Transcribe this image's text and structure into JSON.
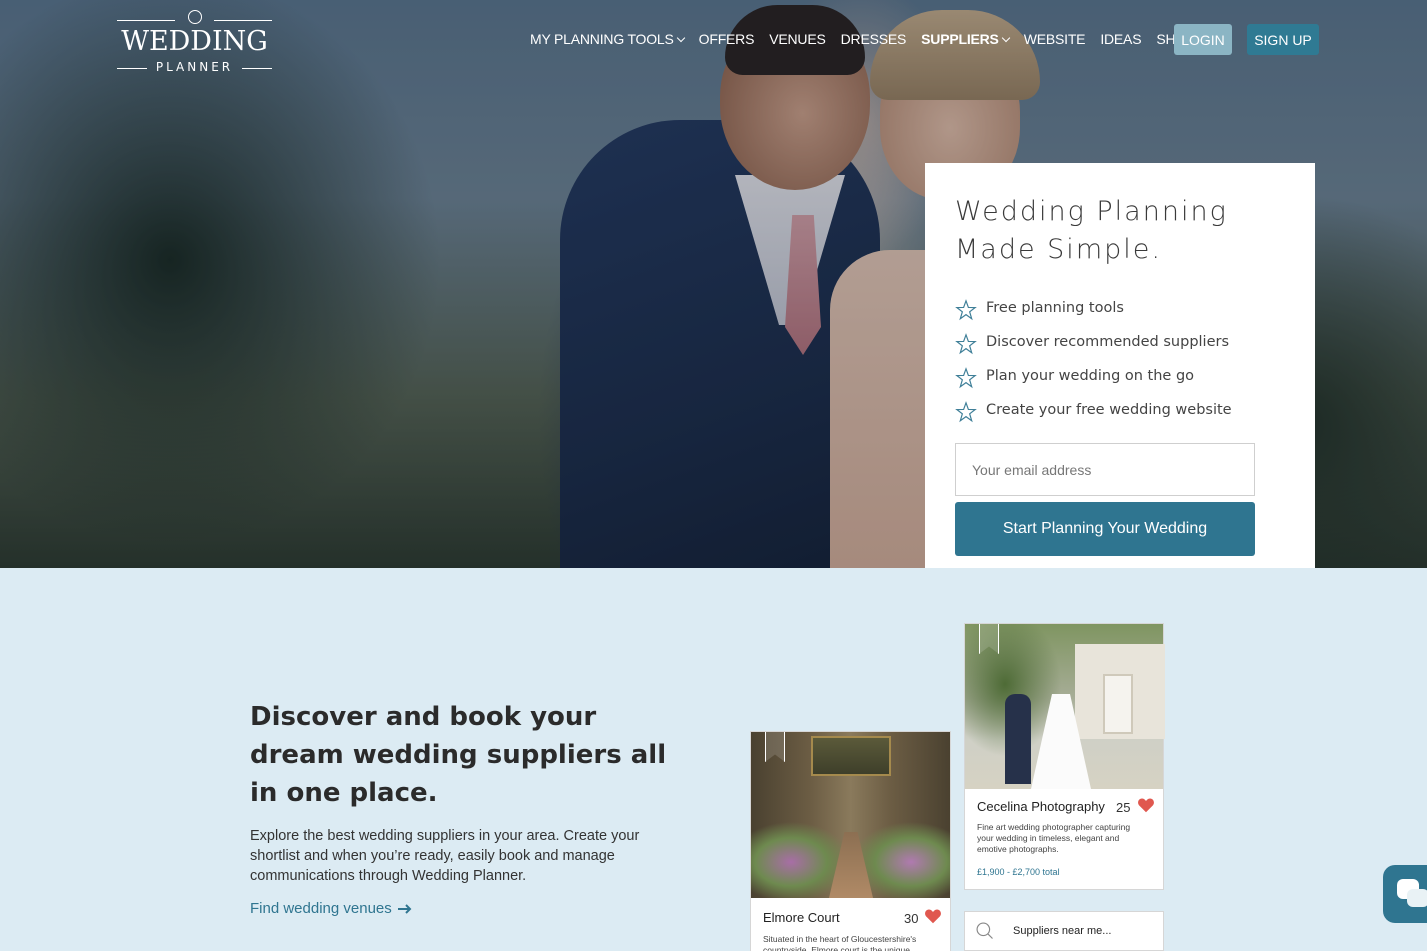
{
  "brand": {
    "logo_main": "WEDDING",
    "logo_sub": "PLANNER"
  },
  "nav": {
    "items": [
      {
        "label": "MY PLANNING TOOLS",
        "dropdown": true,
        "bold": false
      },
      {
        "label": "OFFERS",
        "dropdown": false,
        "bold": false
      },
      {
        "label": "VENUES",
        "dropdown": false,
        "bold": false
      },
      {
        "label": "DRESSES",
        "dropdown": false,
        "bold": false
      },
      {
        "label": "SUPPLIERS",
        "dropdown": true,
        "bold": true
      },
      {
        "label": "WEBSITE",
        "dropdown": false,
        "bold": false
      },
      {
        "label": "IDEAS",
        "dropdown": false,
        "bold": false
      },
      {
        "label": "SHOP",
        "dropdown": false,
        "bold": false
      }
    ],
    "login_label": "LOGIN",
    "signup_label": "SIGN UP"
  },
  "hero": {
    "title": "Wedding Planning Made Simple.",
    "features": [
      "Free planning tools",
      "Discover recommended suppliers",
      "Plan your wedding on the go",
      "Create your free wedding website"
    ],
    "email_placeholder": "Your email address",
    "cta_label": "Start Planning Your Wedding"
  },
  "discover": {
    "title": "Discover and book your dream wedding suppliers all in one place.",
    "text": "Explore the best wedding suppliers in your area. Create your shortlist and when you’re ready, easily book and manage communications through Wedding Planner.",
    "link_label": "Find wedding venues"
  },
  "cards": {
    "elmore": {
      "name": "Elmore Court",
      "count": "30",
      "desc": "Situated in the heart of Gloucestershire's countryside, Elmore court is the unique"
    },
    "cecelina": {
      "name": "Cecelina Photography",
      "count": "25",
      "desc": "Fine art wedding photographer capturing your wedding in timeless, elegant and emotive photographs.",
      "price": "£1,900 - £2,700 total"
    },
    "search_text": "Suppliers near me..."
  },
  "colors": {
    "accent": "#2f7590",
    "login_bg": "#8bb5c4",
    "section_bg": "#dcebf3",
    "heart": "#e0584f"
  },
  "icons": [
    "ring-icon",
    "chevron-down-icon",
    "star-icon",
    "arrow-right-icon",
    "bookmark-icon",
    "heart-icon",
    "search-icon",
    "chat-icon"
  ]
}
